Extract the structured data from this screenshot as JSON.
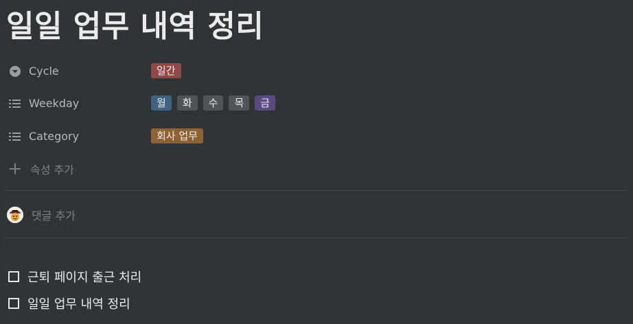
{
  "page": {
    "title": "일일 업무 내역 정리"
  },
  "properties": [
    {
      "icon": "select-icon",
      "name": "Cycle",
      "tags": [
        {
          "label": "일간",
          "color": "#8f4a48"
        }
      ]
    },
    {
      "icon": "multi-select-list-icon",
      "name": "Weekday",
      "tags": [
        {
          "label": "월",
          "color": "#3e627f"
        },
        {
          "label": "화",
          "color": "#505456"
        },
        {
          "label": "수",
          "color": "#505456"
        },
        {
          "label": "목",
          "color": "#505456"
        },
        {
          "label": "금",
          "color": "#5b4a80"
        }
      ]
    },
    {
      "icon": "multi-select-list-icon",
      "name": "Category",
      "tags": [
        {
          "label": "회사 업무",
          "color": "#8f6234"
        }
      ]
    }
  ],
  "add_property": {
    "icon": "plus-icon",
    "label": "속성 추가"
  },
  "comment": {
    "icon": "user-avatar",
    "placeholder": "댓글 추가"
  },
  "todos": [
    {
      "text": "근퇴 페이지 출근 처리",
      "checked": false
    },
    {
      "text": "일일 업무 내역 정리",
      "checked": false
    }
  ],
  "colors": {
    "background": "#2f3437",
    "text": "#ebebea",
    "muted": "#7f8284",
    "divider": "#43484b"
  }
}
